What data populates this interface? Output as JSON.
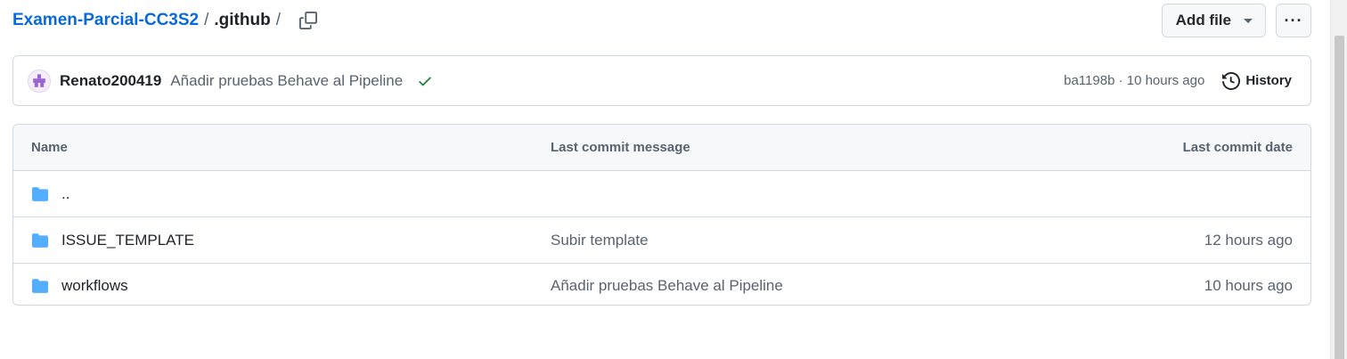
{
  "breadcrumb": {
    "repo": "Examen-Parcial-CC3S2",
    "sep1": "/",
    "current": ".github",
    "sep2": "/"
  },
  "actions": {
    "add_file": "Add file",
    "more": "···"
  },
  "commit": {
    "author": "Renato200419",
    "message": "Añadir pruebas Behave al Pipeline",
    "sha_time": "ba1198b · 10 hours ago",
    "history": "History",
    "status_color": "#1a7f37"
  },
  "table": {
    "headers": {
      "name": "Name",
      "message": "Last commit message",
      "date": "Last commit date"
    },
    "rows": [
      {
        "name": "..",
        "message": "",
        "date": ""
      },
      {
        "name": "ISSUE_TEMPLATE",
        "message": "Subir template",
        "date": "12 hours ago"
      },
      {
        "name": "workflows",
        "message": "Añadir pruebas Behave al Pipeline",
        "date": "10 hours ago"
      }
    ]
  },
  "colors": {
    "link": "#0969da",
    "folder": "#54aeff",
    "muted": "#59636e"
  }
}
